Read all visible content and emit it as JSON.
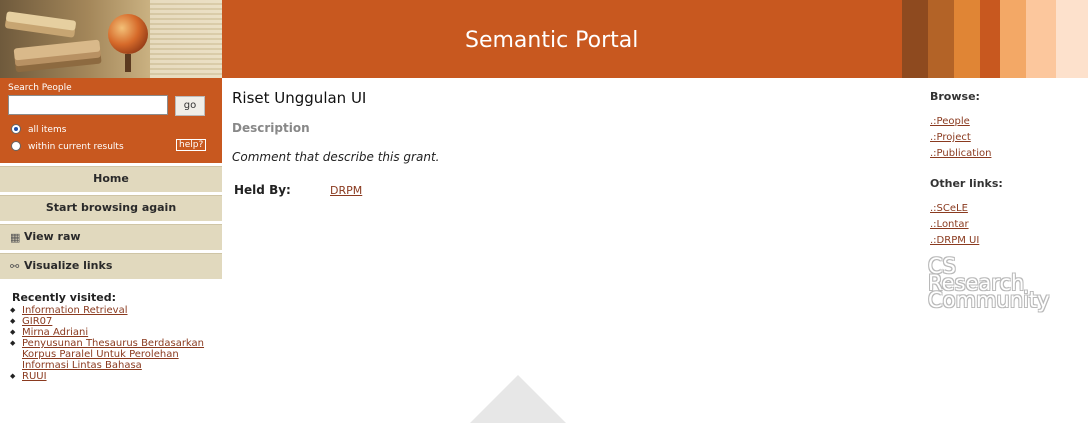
{
  "header": {
    "title": "Semantic Portal",
    "brand_color": "#c8581f",
    "stripe_colors": [
      "#8e4a1f",
      "#b36327",
      "#e08535",
      "#f3a866",
      "#fcc79d",
      "#fde1cc"
    ]
  },
  "search": {
    "label": "Search People",
    "value": "",
    "button_label": "go",
    "options": [
      {
        "label": "all items",
        "selected": true
      },
      {
        "label": "within current results",
        "selected": false
      }
    ],
    "help_label": "help?"
  },
  "nav": {
    "home": "Home",
    "start_browsing": "Start browsing again",
    "view_raw": "View raw",
    "visualize_links": "Visualize links",
    "view_raw_icon": "grid-icon",
    "visualize_icon": "link-graph-icon"
  },
  "recent": {
    "title": "Recently visited:",
    "items": [
      "Information Retrieval",
      "GIR07",
      "Mirna Adriani",
      "Penyusunan Thesaurus Berdasarkan Korpus Paralel Untuk Perolehan Informasi Lintas Bahasa",
      "RUUI"
    ]
  },
  "main": {
    "title": "Riset Unggulan UI",
    "description_heading": "Description",
    "description_text": "Comment that describe this grant.",
    "held_by_label": "Held By:",
    "held_by_value": "DRPM"
  },
  "right": {
    "browse_heading": "Browse:",
    "browse_links": [
      ".:People",
      ".:Project",
      ".:Publication"
    ],
    "other_heading": "Other links:",
    "other_links": [
      ".:SCeLE",
      ".:Lontar",
      ".:DRPM UI"
    ],
    "logo_lines": [
      "CS",
      "Research",
      "Community"
    ]
  }
}
